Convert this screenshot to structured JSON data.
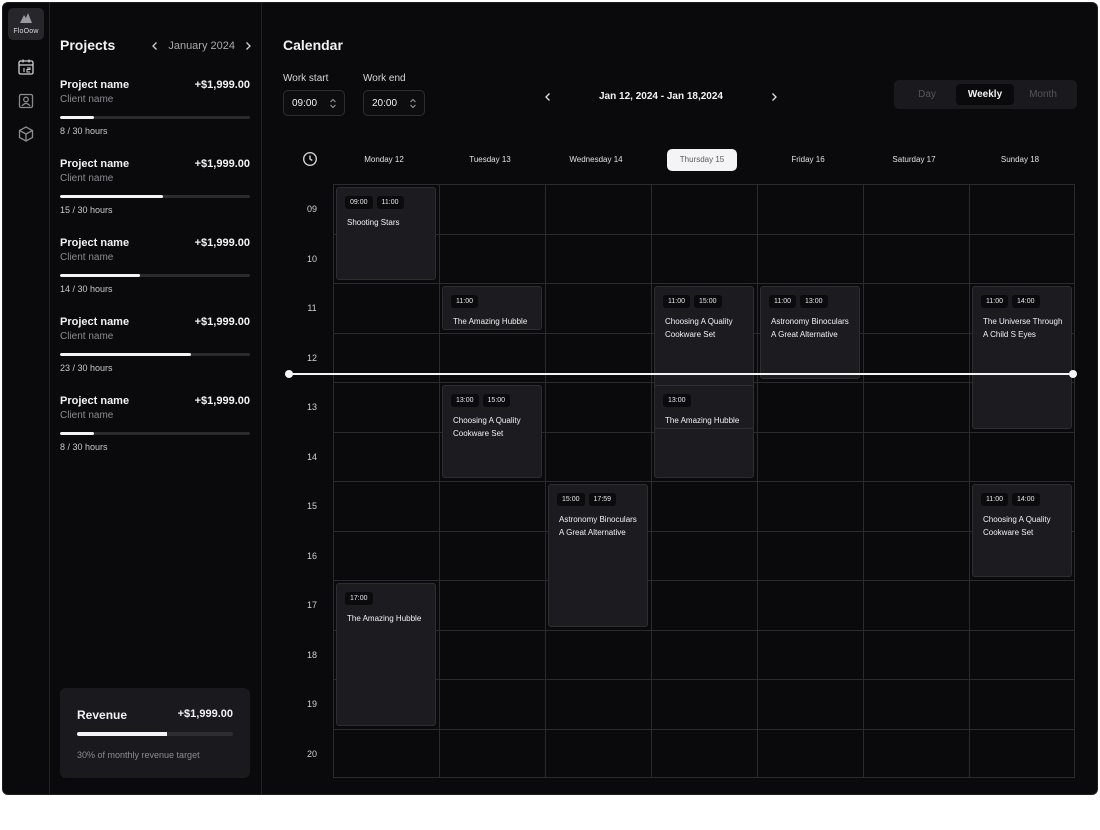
{
  "app": {
    "logo_text": "FloOow"
  },
  "rail": {
    "icons": [
      "calendar-icon",
      "contact-icon",
      "cube-icon"
    ]
  },
  "projects": {
    "title": "Projects",
    "month": "January 2024",
    "items": [
      {
        "name": "Project name",
        "amount": "+$1,999.00",
        "client": "Client name",
        "hours": "8 / 30 hours",
        "progress": 0.18
      },
      {
        "name": "Project name",
        "amount": "+$1,999.00",
        "client": "Client name",
        "hours": "15 / 30 hours",
        "progress": 0.54
      },
      {
        "name": "Project name",
        "amount": "+$1,999.00",
        "client": "Client name",
        "hours": "14 / 30 hours",
        "progress": 0.42
      },
      {
        "name": "Project name",
        "amount": "+$1,999.00",
        "client": "Client name",
        "hours": "23 / 30 hours",
        "progress": 0.69
      },
      {
        "name": "Project name",
        "amount": "+$1,999.00",
        "client": "Client name",
        "hours": "8 / 30 hours",
        "progress": 0.18
      }
    ],
    "revenue": {
      "label": "Revenue",
      "amount": "+$1,999.00",
      "note": "30% of monthly revenue target",
      "progress": 0.58
    }
  },
  "calendar": {
    "title": "Calendar",
    "work_start_label": "Work start",
    "work_start_value": "09:00",
    "work_end_label": "Work end",
    "work_end_value": "20:00",
    "range": "Jan 12, 2024 - Jan 18,2024",
    "views": [
      "Day",
      "Weekly",
      "Month"
    ],
    "active_view": "Weekly",
    "days": [
      "Monday 12",
      "Tuesday 13",
      "Wednesday 14",
      "Thursday 15",
      "Friday 16",
      "Saturday 17",
      "Sunday 18"
    ],
    "today_index": 3,
    "hours": [
      "09",
      "10",
      "11",
      "12",
      "13",
      "14",
      "15",
      "16",
      "17",
      "18",
      "19",
      "20"
    ],
    "events": [
      {
        "day": 0,
        "start": "09:00",
        "end": "11:00",
        "title": "Shooting Stars"
      },
      {
        "day": 1,
        "start": "11:00",
        "end": "",
        "title": "The Amazing Hubble"
      },
      {
        "day": 3,
        "start": "11:00",
        "end": "15:00",
        "title": "Choosing A Quality Cookware Set"
      },
      {
        "day": 4,
        "start": "11:00",
        "end": "13:00",
        "title": "Astronomy Binoculars A Great Alternative"
      },
      {
        "day": 6,
        "start": "11:00",
        "end": "14:00",
        "title": "The Universe Through A Child S Eyes"
      },
      {
        "day": 1,
        "start": "13:00",
        "end": "15:00",
        "title": "Choosing A Quality Cookware Set"
      },
      {
        "day": 3,
        "start": "13:00",
        "end": "",
        "title": "The Amazing Hubble"
      },
      {
        "day": 2,
        "start": "15:00",
        "end": "17:59",
        "title": "Astronomy Binoculars A Great Alternative"
      },
      {
        "day": 6,
        "start": "11:00",
        "end": "14:00",
        "title": "Choosing A Quality Cookware Set"
      },
      {
        "day": 0,
        "start": "17:00",
        "end": "",
        "title": "The Amazing Hubble"
      }
    ],
    "current_time": "12:30"
  }
}
